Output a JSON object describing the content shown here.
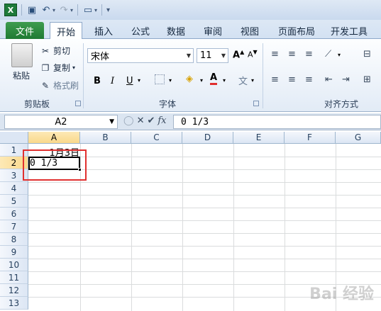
{
  "qat": {
    "app_icon": "X"
  },
  "tabs": {
    "file": "文件",
    "items": [
      "开始",
      "插入",
      "公式",
      "数据",
      "审阅",
      "视图",
      "页面布局",
      "开发工具"
    ]
  },
  "clipboard": {
    "paste": "粘贴",
    "cut": "剪切",
    "copy": "复制",
    "format_painter": "格式刷",
    "group": "剪贴板"
  },
  "font": {
    "name": "宋体",
    "size": "11",
    "bold": "B",
    "italic": "I",
    "underline": "U",
    "group": "字体",
    "accent_color": "#e0302f"
  },
  "alignment": {
    "group": "对齐方式"
  },
  "formula_bar": {
    "name_box": "A2",
    "fx": "fx",
    "content": "0 1/3"
  },
  "sheet": {
    "columns": [
      "A",
      "B",
      "C",
      "D",
      "E",
      "F",
      "G"
    ],
    "rows": [
      "1",
      "2",
      "3",
      "4",
      "5",
      "6",
      "7",
      "8",
      "9",
      "10",
      "11",
      "12",
      "13"
    ],
    "cells": {
      "A1": "1月3日",
      "A2": "0 1/3"
    }
  },
  "watermark": "Bai 经验",
  "colors": {
    "file_tab": "#1f7a33",
    "highlight": "#e0302f",
    "header_selected": "#f9d88b"
  }
}
